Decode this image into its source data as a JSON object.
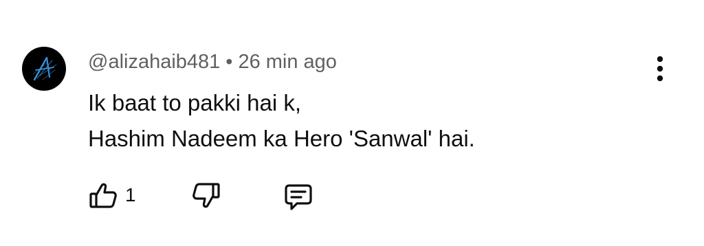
{
  "comment": {
    "author": "@alizahaib481",
    "separator": "•",
    "time": "26 min ago",
    "text_lines": [
      "Ik baat to pakki hai k,",
      "Hashim Nadeem ka Hero 'Sanwal' hai."
    ],
    "like_count": "1"
  },
  "icons": {
    "avatar": "avatar-stylized-a-logo",
    "more": "more-vertical-icon",
    "like": "thumbs-up-icon",
    "dislike": "thumbs-down-icon",
    "reply": "comment-reply-icon"
  },
  "colors": {
    "text_primary": "#0f0f0f",
    "text_secondary": "#606060",
    "avatar_bg": "#000000",
    "avatar_accent": "#3a8fd8"
  }
}
